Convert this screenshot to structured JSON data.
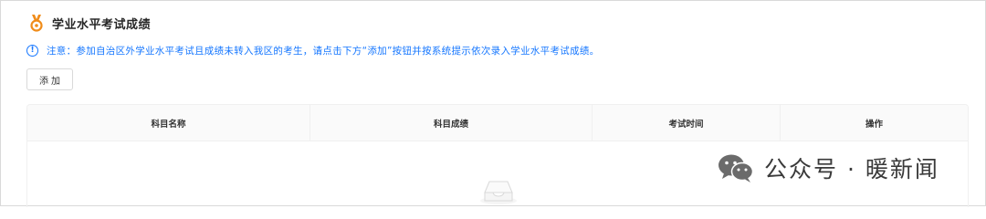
{
  "header": {
    "title": "学业水平考试成绩",
    "accent_color": "#f08c1a"
  },
  "notice": {
    "icon": "info-circle-icon",
    "text": "注意：参加自治区外学业水平考试且成绩未转入我区的考生，请点击下方“添加”按钮并按系统提示依次录入学业水平考试成绩。",
    "color": "#1677ff"
  },
  "actions": {
    "add_label": "添加"
  },
  "table": {
    "columns": [
      "科目名称",
      "科目成绩",
      "考试时间",
      "操作"
    ],
    "rows": [],
    "empty_icon": "empty-inbox-icon"
  },
  "watermark": {
    "icon": "wechat-icon",
    "text": "公众号 · 暖新闻"
  }
}
